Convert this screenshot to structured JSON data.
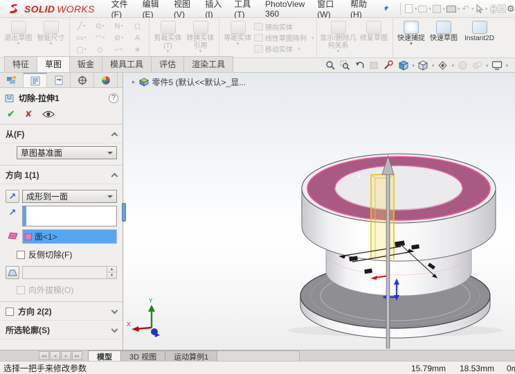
{
  "titlebar": {
    "logo_solid": "SOLID",
    "logo_works": "WORKS",
    "menus": [
      "文件(F)",
      "编辑(E)",
      "视图(V)",
      "插入(I)",
      "工具(T)",
      "PhotoView 360",
      "窗口(W)",
      "帮助(H)"
    ]
  },
  "ribbon": {
    "tabs": [
      "特征",
      "草图",
      "钣金",
      "模具工具",
      "评估",
      "渲染工具"
    ],
    "active_tab": "草图",
    "buttons": {
      "exit_sketch": "退出草图",
      "smart_dimension": "智能尺寸",
      "trim_entities": "剪裁实体(T)",
      "convert_entities": "转换实体引用",
      "offset_entities": "等距实体",
      "mirror_entities": "镜向实体",
      "linear_pattern": "线性草图阵列",
      "move_entities": "移动实体",
      "display_relations": "显示/删除几何关系",
      "repair_sketch": "修复草图",
      "quick_snaps": "快速捕捉",
      "rapid_sketch": "快速草图",
      "instant2d": "Instant2D"
    },
    "sketch_icons": [
      "╱",
      "⊙",
      "N",
      "◻",
      "▭",
      "◠",
      "⊘",
      "A",
      "▢",
      "◇",
      "⌐",
      "∗"
    ]
  },
  "property_panel": {
    "title": "切除-拉伸1",
    "help_glyph": "?",
    "confirm_glyph": "✔",
    "cancel_glyph": "✘",
    "from_section": {
      "label": "从(F)",
      "value": "草图基准面"
    },
    "direction1": {
      "label": "方向 1(1)",
      "end_condition": "成形到一面",
      "direction_arrow": "↗",
      "face_item": "面<1>",
      "flip_side_label": "反侧切除(F)",
      "draft_value": "",
      "draft_outward_label": "向外拔模(O)"
    },
    "direction2": {
      "label": "方向 2(2)"
    },
    "contours": {
      "label": "所选轮廓(S)"
    }
  },
  "viewport": {
    "tree_item": "零件5 (默认<<默认>_显...",
    "tree_expand_glyph": "▸"
  },
  "bottom_bar": {
    "nav_glyphs": [
      "◂◂",
      "◂",
      "▸",
      "▸▸"
    ],
    "tabs": [
      "模型",
      "3D 视图",
      "运动算例1"
    ],
    "active_tab": "模型"
  },
  "statusbar": {
    "message": "选择一把手来修改参数",
    "coord_x": "15.79mm",
    "coord_y": "18.53mm",
    "coord_z": "0m"
  },
  "colors": {
    "logo_red": "#c8281e",
    "selection_blue": "#58a6f2",
    "selected_face_pink": "#a85a83",
    "face_rim_pink": "#f257a0",
    "preview_yellow": "#e9c321",
    "accent_blue": "#6f9fd4"
  }
}
